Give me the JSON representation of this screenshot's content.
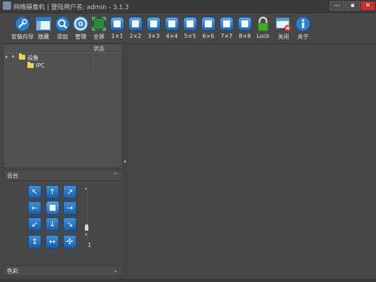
{
  "window": {
    "title": "网络摄像机 | 登陆用户名: admin - 3.1.3",
    "min_label": "—",
    "max_label": "▪",
    "close_label": "✕"
  },
  "toolbar": {
    "items": [
      {
        "label": "安装向导",
        "icon": "wizard-icon"
      },
      {
        "label": "隐藏",
        "icon": "window-icon"
      },
      {
        "label": "添加",
        "icon": "search-add-icon"
      },
      {
        "label": "管理",
        "icon": "gear-icon"
      },
      {
        "label": "全屏",
        "icon": "fullscreen-icon"
      },
      {
        "label": "1×1",
        "icon": "grid-1x1-icon"
      },
      {
        "label": "2×2",
        "icon": "grid-2x2-icon"
      },
      {
        "label": "3×3",
        "icon": "grid-3x3-icon"
      },
      {
        "label": "4×4",
        "icon": "grid-4x4-icon"
      },
      {
        "label": "5×5",
        "icon": "grid-5x5-icon"
      },
      {
        "label": "6×6",
        "icon": "grid-6x6-icon"
      },
      {
        "label": "7×7",
        "icon": "grid-7x7-icon"
      },
      {
        "label": "8×8",
        "icon": "grid-8x8-icon"
      },
      {
        "label": "Lock",
        "icon": "lock-icon"
      },
      {
        "label": "关闭",
        "icon": "close-window-icon"
      },
      {
        "label": "关于",
        "icon": "info-icon"
      }
    ]
  },
  "tree": {
    "status_header": "状态",
    "root_label": "设备",
    "child_label": "IPC"
  },
  "ptz": {
    "title": "云台",
    "collapse_arrow": "⌃",
    "speed_value": "1"
  },
  "color": {
    "title": "色彩",
    "expand_arrow": "⌄"
  },
  "colors": {
    "accent": "#1f6fc0",
    "background": "#464646"
  }
}
